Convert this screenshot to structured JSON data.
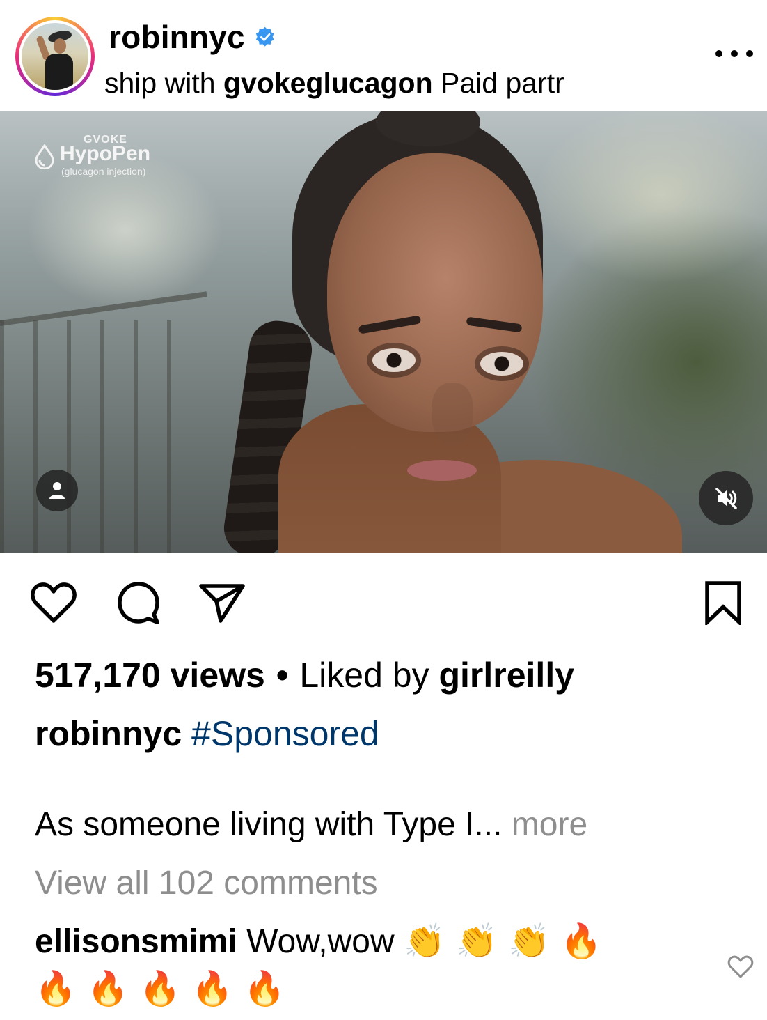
{
  "header": {
    "username": "robinnyc",
    "verified_icon": "verified-badge-icon",
    "subline_prefix": "ship with ",
    "subline_partner": "gvokeglucagon",
    "subline_suffix": "  Paid partr",
    "more_icon": "more-options-icon"
  },
  "media": {
    "brand_top": "GVOKE",
    "brand_name": "HypoPen",
    "brand_sub": "(glucagon injection)",
    "tag_icon": "person-tag-icon",
    "mute_icon": "muted-speaker-icon"
  },
  "actions": {
    "like_icon": "heart-icon",
    "comment_icon": "comment-icon",
    "share_icon": "send-icon",
    "save_icon": "bookmark-icon"
  },
  "stats": {
    "views": "517,170 views",
    "separator": "•",
    "liked_by_prefix": "Liked by ",
    "liked_by_user": "girlreilly"
  },
  "caption": {
    "username": "robinnyc",
    "hashtag": "#Sponsored",
    "text": "As someone living with Type I... ",
    "more": "more"
  },
  "comments": {
    "view_all": "View all 102 comments",
    "top_comment_user": "ellisonsmimi",
    "top_comment_text": "Wow,wow",
    "top_comment_emojis_line1": "👏 👏 👏 🔥",
    "top_comment_emojis_line2": "🔥 🔥 🔥 🔥 🔥",
    "comment_like_icon": "small-heart-icon"
  },
  "colors": {
    "hashtag": "#00376b",
    "muted_text": "#8e8e8e",
    "verified": "#3897f0"
  }
}
